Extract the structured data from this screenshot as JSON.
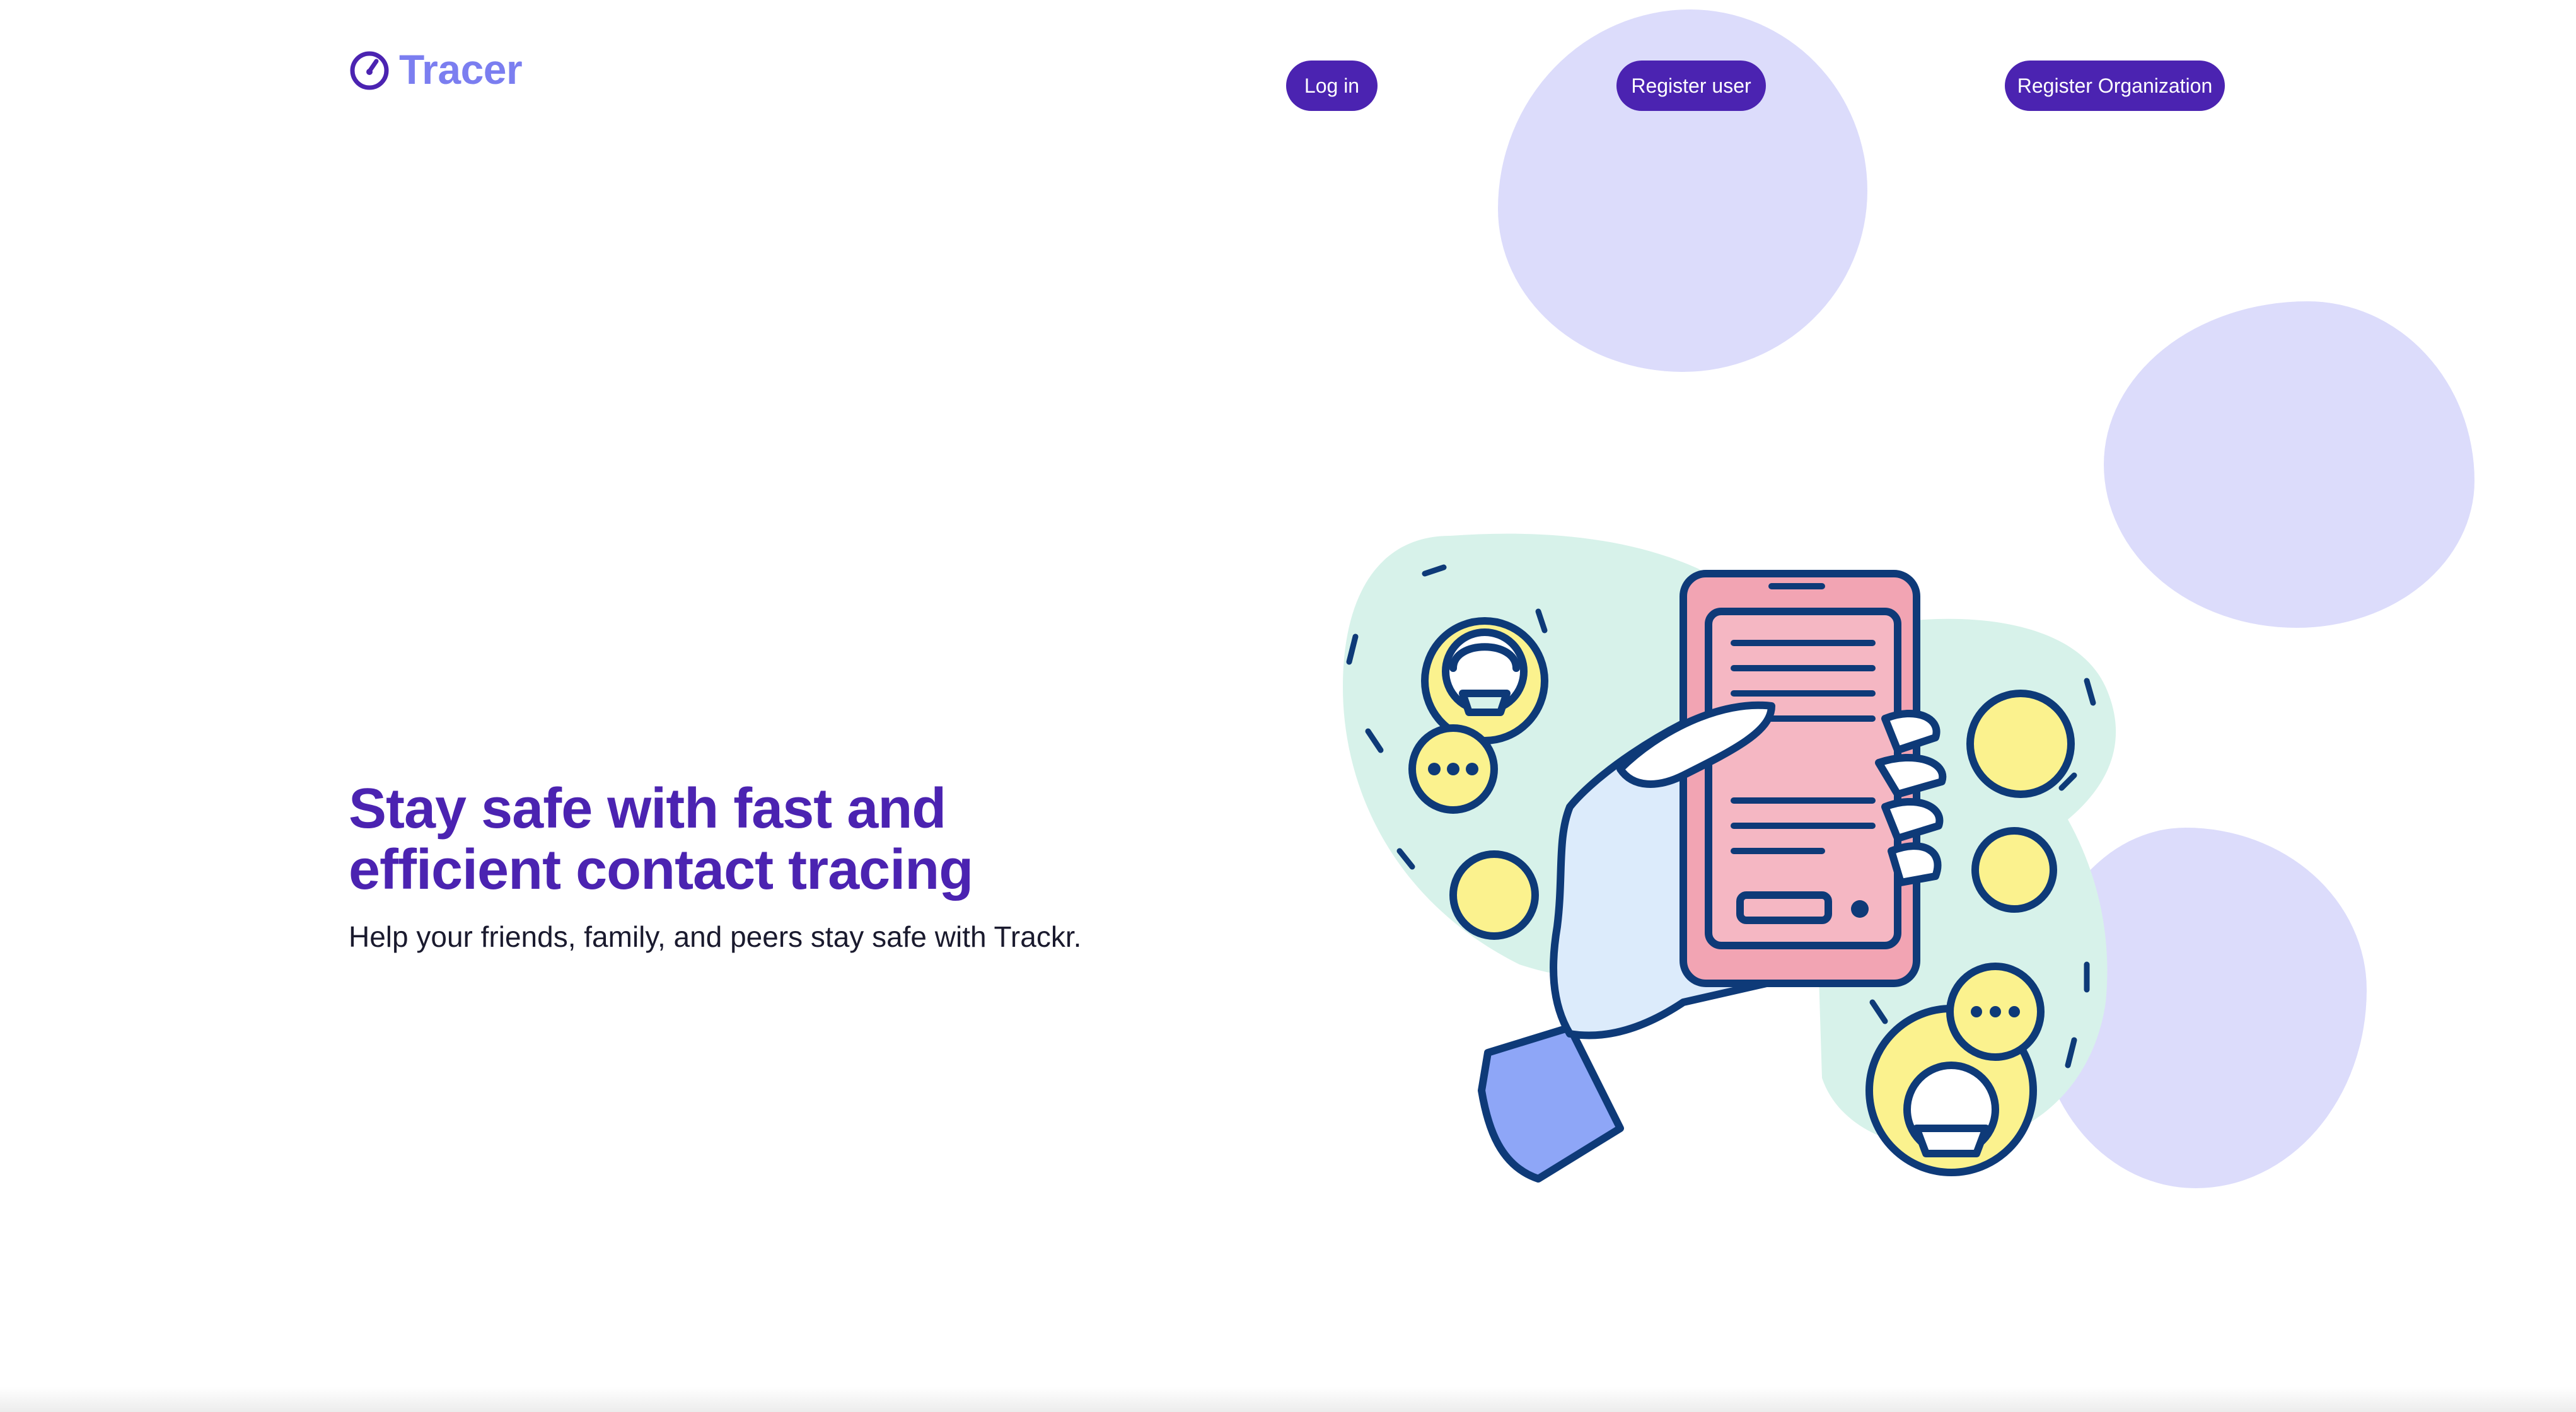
{
  "brand": {
    "name": "Tracer",
    "logo_icon": "gauge-icon",
    "color": "#7b7ef0"
  },
  "nav": {
    "login_label": "Log in",
    "register_user_label": "Register user",
    "register_org_label": "Register Organization"
  },
  "hero": {
    "title": "Stay safe with fast and efficient contact tracing",
    "subtitle": "Help your friends, family, and peers stay safe with Trackr."
  },
  "illustration": {
    "icon": "hand-holding-phone-icon"
  },
  "colors": {
    "primary": "#4b23b1",
    "blob": "#dcdcfb",
    "mint": "#d7f2ea",
    "yellow": "#fbf28e",
    "pink": "#f2a4b3",
    "outline": "#0e3a78"
  }
}
